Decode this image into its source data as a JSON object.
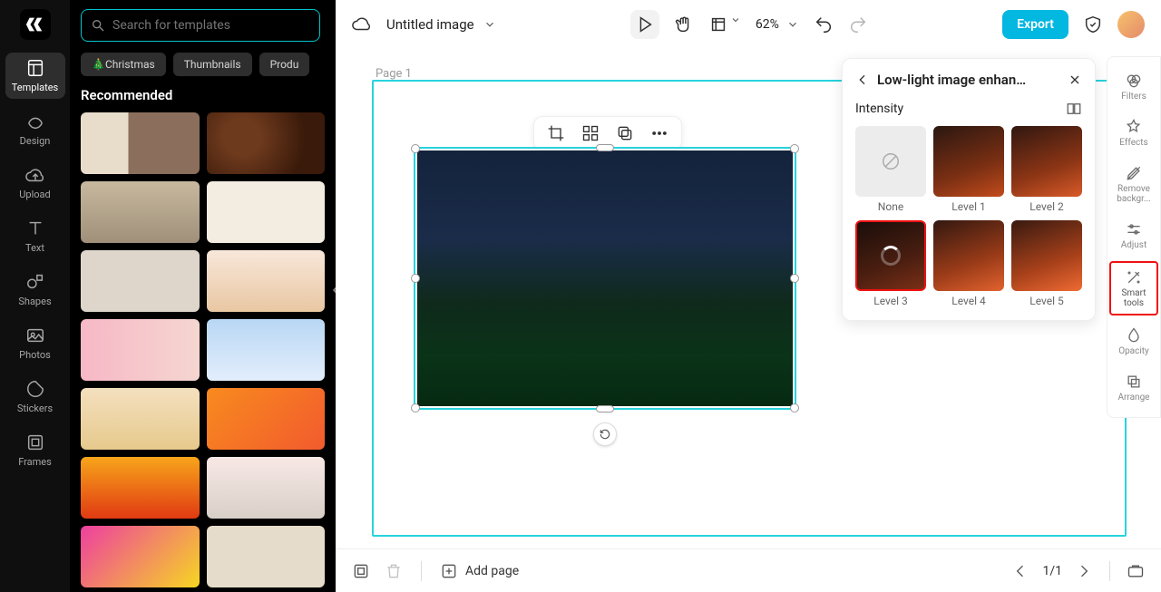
{
  "leftRail": {
    "items": [
      {
        "label": "Templates"
      },
      {
        "label": "Design"
      },
      {
        "label": "Upload"
      },
      {
        "label": "Text"
      },
      {
        "label": "Shapes"
      },
      {
        "label": "Photos"
      },
      {
        "label": "Stickers"
      },
      {
        "label": "Frames"
      }
    ]
  },
  "templatesPanel": {
    "searchPlaceholder": "Search for templates",
    "chips": [
      "🎄Christmas",
      "Thumbnails",
      "Produ"
    ],
    "sectionTitle": "Recommended"
  },
  "topbar": {
    "title": "Untitled image",
    "zoom": "62%",
    "export": "Export"
  },
  "canvas": {
    "pageLabel": "Page 1"
  },
  "rightRail": {
    "items": [
      {
        "label": "Filters"
      },
      {
        "label": "Effects"
      },
      {
        "label": "Remove backgr..."
      },
      {
        "label": "Adjust"
      },
      {
        "label": "Smart tools"
      },
      {
        "label": "Opacity"
      },
      {
        "label": "Arrange"
      }
    ]
  },
  "popover": {
    "title": "Low-light image enhan…",
    "intensityLabel": "Intensity",
    "levels": [
      "None",
      "Level 1",
      "Level 2",
      "Level 3",
      "Level 4",
      "Level 5"
    ]
  },
  "bottombar": {
    "addPage": "Add page",
    "pageIndicator": "1/1"
  }
}
